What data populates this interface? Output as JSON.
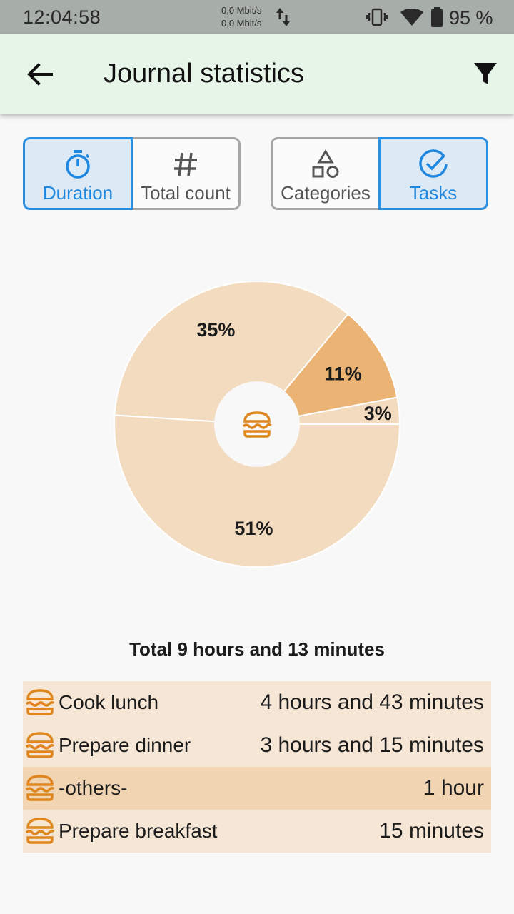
{
  "status_bar": {
    "time": "12:04:58",
    "net_up": "0,0 Mbit/s",
    "net_down": "0,0 Mbit/s",
    "battery": "95 %"
  },
  "app_bar": {
    "title": "Journal statistics",
    "back_icon": "arrow-back-icon",
    "filter_icon": "filter-icon"
  },
  "mode_toggle": {
    "duration": "Duration",
    "total_count": "Total count",
    "selected": "Duration"
  },
  "group_toggle": {
    "categories": "Categories",
    "tasks": "Tasks",
    "selected": "Tasks"
  },
  "chart_data": {
    "type": "pie",
    "center_icon": "burger-icon",
    "slices": [
      {
        "label": "35%",
        "value": 35,
        "color": "#f3dbbf"
      },
      {
        "label": "11%",
        "value": 11,
        "color": "#ebb474"
      },
      {
        "label": "3%",
        "value": 3,
        "color": "#f3dbbf"
      },
      {
        "label": "51%",
        "value": 51,
        "color": "#f3dbbf"
      }
    ]
  },
  "total": "Total 9 hours and 13 minutes",
  "rows": [
    {
      "name": "Cook lunch",
      "value": "4 hours and 43 minutes",
      "icon": "burger-icon"
    },
    {
      "name": "Prepare dinner",
      "value": "3 hours and 15 minutes",
      "icon": "burger-icon"
    },
    {
      "name": "-others-",
      "value": "1 hour",
      "icon": "burger-icon"
    },
    {
      "name": "Prepare breakfast",
      "value": "15 minutes",
      "icon": "burger-icon"
    }
  ],
  "colors": {
    "accent": "#2a8fe0",
    "app_bar": "#e7f5e8",
    "icon_orange": "#e0861e",
    "row_bg": "#f6e6d6",
    "row_highlight": "#f1d5b3"
  }
}
